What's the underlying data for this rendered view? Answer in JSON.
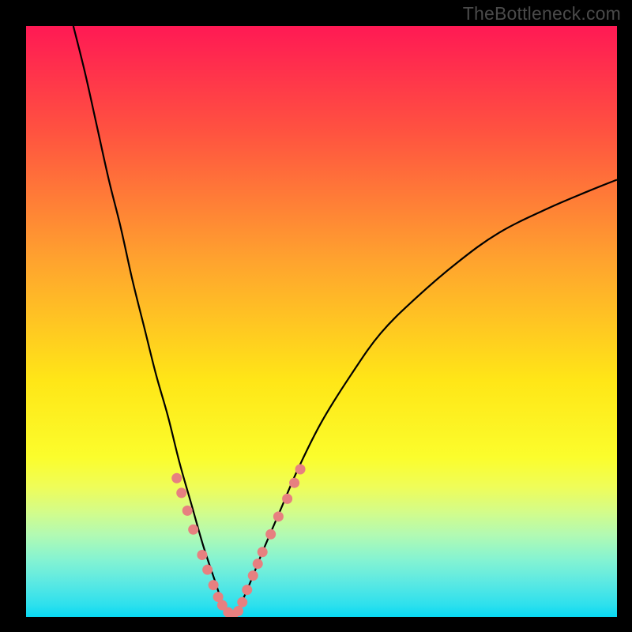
{
  "watermark": "TheBottleneck.com",
  "chart_data": {
    "type": "line",
    "title": "",
    "xlabel": "",
    "ylabel": "",
    "ylim": [
      0,
      100
    ],
    "xlim": [
      0,
      100
    ],
    "left_curve": {
      "x": [
        8,
        10,
        12,
        14,
        16,
        18,
        20,
        22,
        24,
        26,
        28,
        30,
        32,
        33,
        34,
        35
      ],
      "y": [
        100,
        92,
        83,
        74,
        66,
        57,
        49,
        41,
        34,
        26,
        19,
        12,
        6,
        3,
        1.2,
        0.3
      ]
    },
    "right_curve": {
      "x": [
        35,
        36,
        38,
        40,
        43,
        46,
        50,
        55,
        60,
        66,
        73,
        80,
        88,
        95,
        100
      ],
      "y": [
        0.3,
        1.5,
        6,
        11,
        18,
        25,
        33,
        41,
        48,
        54,
        60,
        65,
        69,
        72,
        74
      ]
    },
    "dots_left": {
      "x": [
        25.5,
        26.3,
        27.3,
        28.3,
        29.8,
        30.7,
        31.7,
        32.5,
        33.2,
        34.2,
        35.0
      ],
      "y": [
        23.5,
        21.0,
        18.0,
        14.8,
        10.5,
        8.0,
        5.4,
        3.4,
        2.0,
        0.8,
        0.3
      ]
    },
    "dots_right": {
      "x": [
        35.9,
        36.6,
        37.4,
        38.4,
        39.2,
        40.0,
        41.4,
        42.7,
        44.2,
        45.4,
        46.4
      ],
      "y": [
        1.0,
        2.5,
        4.6,
        7.0,
        9.0,
        11.0,
        14.0,
        17.0,
        20.0,
        22.7,
        25.0
      ]
    },
    "colors": {
      "dot_fill": "#e78080",
      "curve": "#000000"
    }
  }
}
